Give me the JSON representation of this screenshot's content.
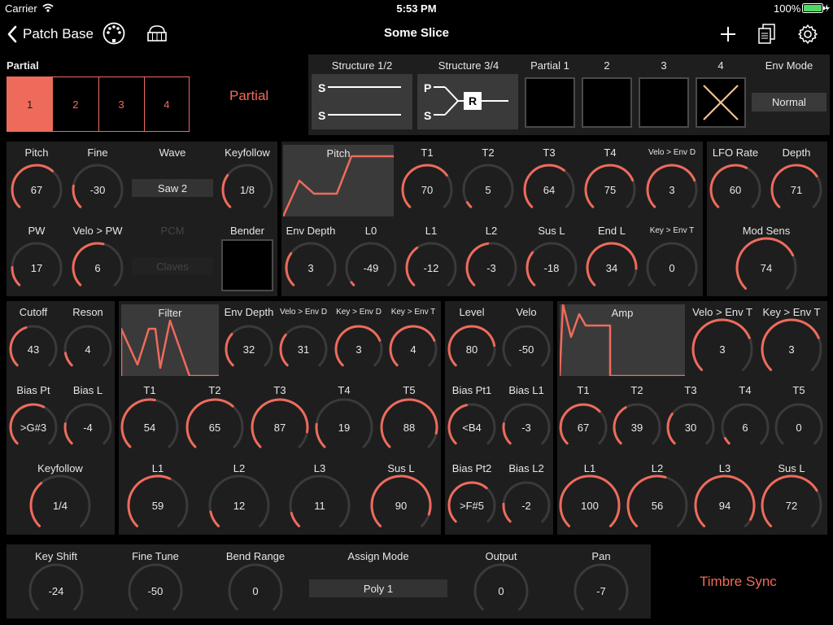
{
  "status": {
    "carrier": "Carrier",
    "time": "5:53 PM",
    "battery": "100%"
  },
  "nav": {
    "back_label": "Patch Base",
    "title": "Some Slice"
  },
  "colors": {
    "accent": "#ee6b5c",
    "panel": "#1e1e1e",
    "track": "#3a3a3a",
    "cross": "#f2c28a"
  },
  "partial": {
    "header": "Partial",
    "tabs": [
      "1",
      "2",
      "3",
      "4"
    ],
    "selected_index": 0,
    "big_label": "Partial"
  },
  "structure": {
    "s12_label": "Structure 1/2",
    "s34_label": "Structure 3/4",
    "s12_letters": [
      "S",
      "S"
    ],
    "s34_letters": [
      "P",
      "S"
    ],
    "s34_box": "R",
    "partial_labels": [
      "Partial 1",
      "2",
      "3",
      "4"
    ],
    "env_mode_label": "Env Mode",
    "env_mode_value": "Normal"
  },
  "pitch_panel": {
    "pitch": {
      "label": "Pitch",
      "value": "67",
      "level": 0.65
    },
    "fine": {
      "label": "Fine",
      "value": "-30",
      "level": 0.2
    },
    "wave": {
      "label": "Wave",
      "value": "Saw 2"
    },
    "keyfollow": {
      "label": "Keyfollow",
      "value": "1/8",
      "level": 0.3
    },
    "pw": {
      "label": "PW",
      "value": "17",
      "level": 0.17
    },
    "velo_pw": {
      "label": "Velo > PW",
      "value": "6",
      "level": 0.55
    },
    "pcm": {
      "label": "PCM",
      "value": "Claves"
    },
    "bender": {
      "label": "Bender"
    }
  },
  "pitch_env": {
    "graph_label": "Pitch",
    "t1": {
      "label": "T1",
      "value": "70",
      "level": 0.7
    },
    "t2": {
      "label": "T2",
      "value": "5",
      "level": 0.05
    },
    "t3": {
      "label": "T3",
      "value": "64",
      "level": 0.64
    },
    "t4": {
      "label": "T4",
      "value": "75",
      "level": 0.75
    },
    "velo_env": {
      "label": "Velo > Env D",
      "value": "3",
      "level": 0.75
    },
    "env_depth": {
      "label": "Env Depth",
      "value": "3",
      "level": 0.3
    },
    "l0": {
      "label": "L0",
      "value": "-49",
      "level": 0.03
    },
    "l1": {
      "label": "L1",
      "value": "-12",
      "level": 0.37
    },
    "l2": {
      "label": "L2",
      "value": "-3",
      "level": 0.47
    },
    "sus_l": {
      "label": "Sus L",
      "value": "-18",
      "level": 0.31
    },
    "end_l": {
      "label": "End L",
      "value": "34",
      "level": 0.84
    },
    "key_env_t": {
      "label": "Key > Env T",
      "value": "0",
      "level": 0.0
    }
  },
  "lfo": {
    "rate": {
      "label": "LFO Rate",
      "value": "60",
      "level": 0.6
    },
    "depth": {
      "label": "Depth",
      "value": "71",
      "level": 0.71
    },
    "mod_sens": {
      "label": "Mod Sens",
      "value": "74",
      "level": 0.74
    }
  },
  "filter_left": {
    "cutoff": {
      "label": "Cutoff",
      "value": "43",
      "level": 0.43
    },
    "reson": {
      "label": "Reson",
      "value": "4",
      "level": 0.13
    },
    "bias_pt": {
      "label": "Bias Pt",
      "value": ">G#3",
      "level": 0.6
    },
    "bias_l": {
      "label": "Bias L",
      "value": "-4",
      "level": 0.2
    },
    "keyfollow": {
      "label": "Keyfollow",
      "value": "1/4",
      "level": 0.35
    }
  },
  "filter_env": {
    "graph_label": "Filter",
    "env_depth": {
      "label": "Env Depth",
      "value": "32",
      "level": 0.32
    },
    "velo_env": {
      "label": "Velo > Env D",
      "value": "31",
      "level": 0.31
    },
    "key_env_d": {
      "label": "Key > Env D",
      "value": "3",
      "level": 0.75
    },
    "key_env_t": {
      "label": "Key > Env T",
      "value": "4",
      "level": 0.75
    },
    "t1": {
      "label": "T1",
      "value": "54",
      "level": 0.54
    },
    "t2": {
      "label": "T2",
      "value": "65",
      "level": 0.65
    },
    "t3": {
      "label": "T3",
      "value": "87",
      "level": 0.87
    },
    "t4": {
      "label": "T4",
      "value": "19",
      "level": 0.19
    },
    "t5": {
      "label": "T5",
      "value": "88",
      "level": 0.88
    },
    "l1": {
      "label": "L1",
      "value": "59",
      "level": 0.59
    },
    "l2": {
      "label": "L2",
      "value": "12",
      "level": 0.12
    },
    "l3": {
      "label": "L3",
      "value": "11",
      "level": 0.11
    },
    "sus_l": {
      "label": "Sus L",
      "value": "90",
      "level": 0.9
    }
  },
  "amp_left": {
    "level": {
      "label": "Level",
      "value": "80",
      "level": 0.8
    },
    "velo": {
      "label": "Velo",
      "value": "-50",
      "level": 0.0
    },
    "bias_pt1": {
      "label": "Bias Pt1",
      "value": "<B4",
      "level": 0.45
    },
    "bias_l1": {
      "label": "Bias L1",
      "value": "-3",
      "level": 0.2
    },
    "bias_pt2": {
      "label": "Bias Pt2",
      "value": ">F#5",
      "level": 0.65
    },
    "bias_l2": {
      "label": "Bias L2",
      "value": "-2",
      "level": 0.18
    }
  },
  "amp_env": {
    "graph_label": "Amp",
    "velo_env_t": {
      "label": "Velo > Env T",
      "value": "3",
      "level": 0.75
    },
    "key_env_t": {
      "label": "Key > Env T",
      "value": "3",
      "level": 0.75
    },
    "t1": {
      "label": "T1",
      "value": "67",
      "level": 0.67
    },
    "t2": {
      "label": "T2",
      "value": "39",
      "level": 0.39
    },
    "t3": {
      "label": "T3",
      "value": "30",
      "level": 0.3
    },
    "t4": {
      "label": "T4",
      "value": "6",
      "level": 0.06
    },
    "t5": {
      "label": "T5",
      "value": "0",
      "level": 0.0
    },
    "l1": {
      "label": "L1",
      "value": "100",
      "level": 1.0
    },
    "l2": {
      "label": "L2",
      "value": "56",
      "level": 0.56
    },
    "l3": {
      "label": "L3",
      "value": "94",
      "level": 0.94
    },
    "sus_l": {
      "label": "Sus L",
      "value": "72",
      "level": 0.72
    }
  },
  "bottom": {
    "key_shift": {
      "label": "Key Shift",
      "value": "-24",
      "level": 0.0
    },
    "fine_tune": {
      "label": "Fine Tune",
      "value": "-50",
      "level": 0.0
    },
    "bend_range": {
      "label": "Bend Range",
      "value": "0",
      "level": 0.0
    },
    "assign_mode": {
      "label": "Assign Mode",
      "value": "Poly 1"
    },
    "output": {
      "label": "Output",
      "value": "0",
      "level": 0.0
    },
    "pan": {
      "label": "Pan",
      "value": "-7",
      "level": 0.0
    },
    "timbre_sync": "Timbre Sync"
  }
}
